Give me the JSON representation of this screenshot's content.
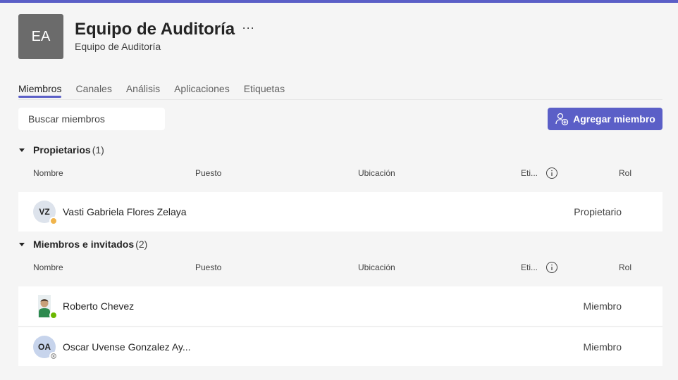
{
  "team": {
    "initials": "EA",
    "title": "Equipo de Auditoría",
    "subtitle": "Equipo de Auditoría",
    "more": "···"
  },
  "tabs": [
    {
      "label": "Miembros",
      "active": true
    },
    {
      "label": "Canales"
    },
    {
      "label": "Análisis"
    },
    {
      "label": "Aplicaciones"
    },
    {
      "label": "Etiquetas"
    }
  ],
  "search": {
    "placeholder": "Buscar miembros"
  },
  "add_button": {
    "label": "Agregar miembro"
  },
  "columns": {
    "name": "Nombre",
    "title": "Puesto",
    "location": "Ubicación",
    "tags": "Eti...",
    "role": "Rol"
  },
  "owners": {
    "title": "Propietarios",
    "count": "(1)",
    "members": [
      {
        "initials": "VZ",
        "name": "Vasti Gabriela Flores Zelaya",
        "role": "Propietario",
        "status": "away"
      }
    ]
  },
  "members": {
    "title": "Miembros e invitados",
    "count": "(2)",
    "members": [
      {
        "initials": "",
        "name": "Roberto Chevez",
        "role": "Miembro",
        "status": "available"
      },
      {
        "initials": "OA",
        "name": "Oscar Uvense Gonzalez Ay...",
        "role": "Miembro",
        "status": "offline"
      }
    ]
  },
  "colors": {
    "accent": "#5b5fc7",
    "away": "#f0b44b",
    "available": "#6bb700",
    "offline": "#8a8a8a"
  }
}
